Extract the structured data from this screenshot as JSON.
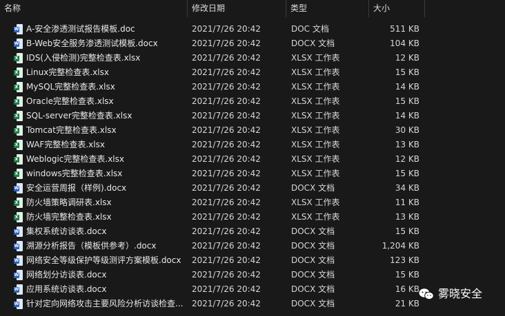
{
  "columns": {
    "name": "名称",
    "date": "修改日期",
    "type": "类型",
    "size": "大小"
  },
  "sort_indicator": "^",
  "files": [
    {
      "name": "A-安全渗透测试报告模板.doc",
      "date": "2021/7/26 20:42",
      "type": "DOC 文档",
      "size": "511 KB",
      "icon": "word-doc-icon"
    },
    {
      "name": "B-Web安全服务渗透测试模板.docx",
      "date": "2021/7/26 20:42",
      "type": "DOCX 文档",
      "size": "104 KB",
      "icon": "word-doc-icon"
    },
    {
      "name": "IDS(入侵检测)完整检查表.xlsx",
      "date": "2021/7/26 20:42",
      "type": "XLSX 工作表",
      "size": "12 KB",
      "icon": "excel-sheet-icon"
    },
    {
      "name": "Linux完整检查表.xlsx",
      "date": "2021/7/26 20:42",
      "type": "XLSX 工作表",
      "size": "15 KB",
      "icon": "excel-sheet-icon"
    },
    {
      "name": "MySQL完整检查表.xlsx",
      "date": "2021/7/26 20:42",
      "type": "XLSX 工作表",
      "size": "14 KB",
      "icon": "excel-sheet-icon"
    },
    {
      "name": "Oracle完整检查表.xlsx",
      "date": "2021/7/26 20:42",
      "type": "XLSX 工作表",
      "size": "15 KB",
      "icon": "excel-sheet-icon"
    },
    {
      "name": "SQL-server完整检查表.xlsx",
      "date": "2021/7/26 20:42",
      "type": "XLSX 工作表",
      "size": "14 KB",
      "icon": "excel-sheet-icon"
    },
    {
      "name": "Tomcat完整检查表.xlsx",
      "date": "2021/7/26 20:42",
      "type": "XLSX 工作表",
      "size": "30 KB",
      "icon": "excel-sheet-icon"
    },
    {
      "name": "WAF完整检查表.xlsx",
      "date": "2021/7/26 20:42",
      "type": "XLSX 工作表",
      "size": "13 KB",
      "icon": "excel-sheet-icon"
    },
    {
      "name": "Weblogic完整检查表.xlsx",
      "date": "2021/7/26 20:42",
      "type": "XLSX 工作表",
      "size": "12 KB",
      "icon": "excel-sheet-icon"
    },
    {
      "name": "windows完整检查表.xlsx",
      "date": "2021/7/26 20:42",
      "type": "XLSX 工作表",
      "size": "15 KB",
      "icon": "excel-sheet-icon"
    },
    {
      "name": "安全运营周报（样例).docx",
      "date": "2021/7/26 20:42",
      "type": "DOCX 文档",
      "size": "34 KB",
      "icon": "word-doc-icon"
    },
    {
      "name": "防火墙策略调研表.xlsx",
      "date": "2021/7/26 20:42",
      "type": "XLSX 工作表",
      "size": "11 KB",
      "icon": "excel-sheet-icon"
    },
    {
      "name": "防火墙完整检查表.xlsx",
      "date": "2021/7/26 20:42",
      "type": "XLSX 工作表",
      "size": "13 KB",
      "icon": "excel-sheet-icon"
    },
    {
      "name": "集权系统访谈表.docx",
      "date": "2021/7/26 20:42",
      "type": "DOCX 文档",
      "size": "15 KB",
      "icon": "word-doc-icon"
    },
    {
      "name": "溯源分析报告（模板供参考）.docx",
      "date": "2021/7/26 20:42",
      "type": "DOCX 文档",
      "size": "1,204 KB",
      "icon": "word-doc-icon"
    },
    {
      "name": "网络安全等级保护等级测评方案模板.docx",
      "date": "2021/7/26 20:42",
      "type": "DOCX 文档",
      "size": "123 KB",
      "icon": "word-doc-icon"
    },
    {
      "name": "网络划分访谈表.docx",
      "date": "2021/7/26 20:42",
      "type": "DOCX 文档",
      "size": "15 KB",
      "icon": "word-doc-icon"
    },
    {
      "name": "应用系统访谈表.docx",
      "date": "2021/7/26 20:42",
      "type": "DOCX 文档",
      "size": "16 KB",
      "icon": "word-doc-icon"
    },
    {
      "name": "针对定向网络攻击主要风险分析访谈检查...",
      "date": "2021/7/26 20:42",
      "type": "DOCX 文档",
      "size": "21 KB",
      "icon": "word-doc-icon"
    }
  ],
  "watermark": {
    "text": "雾晓安全",
    "icon": "wechat-icon"
  },
  "colors": {
    "background": "#191919",
    "text": "#e8e8e8",
    "word_badge": "#2b62c2",
    "excel_badge": "#1f7a43"
  }
}
